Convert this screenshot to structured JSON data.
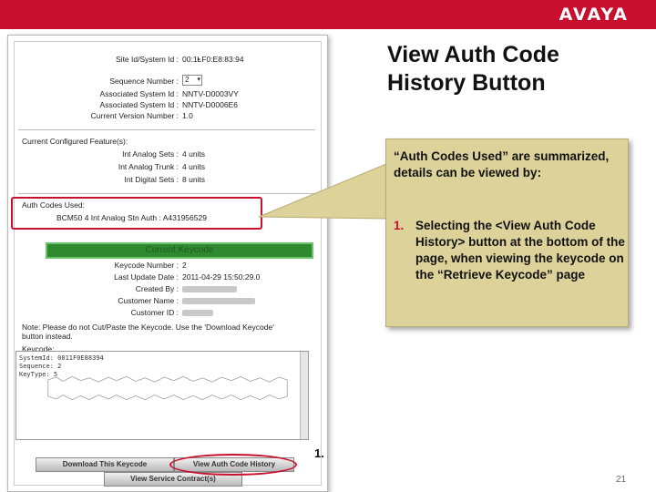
{
  "brand": {
    "logo": "AVAYA",
    "accent": "#c8102e"
  },
  "slide": {
    "title_line1": "View Auth Code",
    "title_line2": "History Button",
    "callout_intro": "“Auth Codes Used” are summarized, details can be viewed by:",
    "step_number": "1.",
    "step_text": "Selecting the <View Auth Code History> button at the bottom of the page, when viewing the keycode on the “Retrieve Keycode” page",
    "marker_label": "1.",
    "page_number": "21"
  },
  "screenshot": {
    "site_id_label": "Site Id/System Id :",
    "site_id_value": "00:1ⱠF0:E8:83:94",
    "seq_label": "Sequence Number :",
    "seq_value": "2",
    "assoc1_label": "Associated System Id :",
    "assoc1_value": "NNTV-D0003VY",
    "assoc2_label": "Associated System Id :",
    "assoc2_value": "NNTV-D0006E6",
    "version_label": "Current Version Number :",
    "version_value": "1.0",
    "features_header": "Current Configured Feature(s):",
    "feat1_label": "Int Analog Sets :",
    "feat1_value": "4 units",
    "feat2_label": "Int Analog Trunk :",
    "feat2_value": "4 units",
    "feat3_label": "Int Digital Sets :",
    "feat3_value": "8 units",
    "auth_header": "Auth Codes Used:",
    "auth_line": "BCM50 4 Int Analog Stn Auth : A431956529",
    "current_keycode": "Current Keycode",
    "keycode_number_label": "Keycode Number :",
    "keycode_number_value": "2",
    "last_update_label": "Last Update Date :",
    "last_update_value": "2011-04-29 15:50:29.0",
    "created_by_label": "Created By :",
    "customer_name_label": "Customer Name :",
    "customer_id_label": "Customer ID :",
    "note_line1": "Note: Please do not Cut/Paste the Keycode. Use the 'Download Keycode'",
    "note_line2": "button instead.",
    "keycode_label": "Keycode:",
    "key_line1": "SystemId: 0011F0E88394",
    "key_line2": "Sequence: 2",
    "key_line3": "KeyType: 5",
    "btn_download": "Download This Keycode",
    "btn_history": "View Auth Code History",
    "btn_service": "View Service Contract(s)"
  }
}
